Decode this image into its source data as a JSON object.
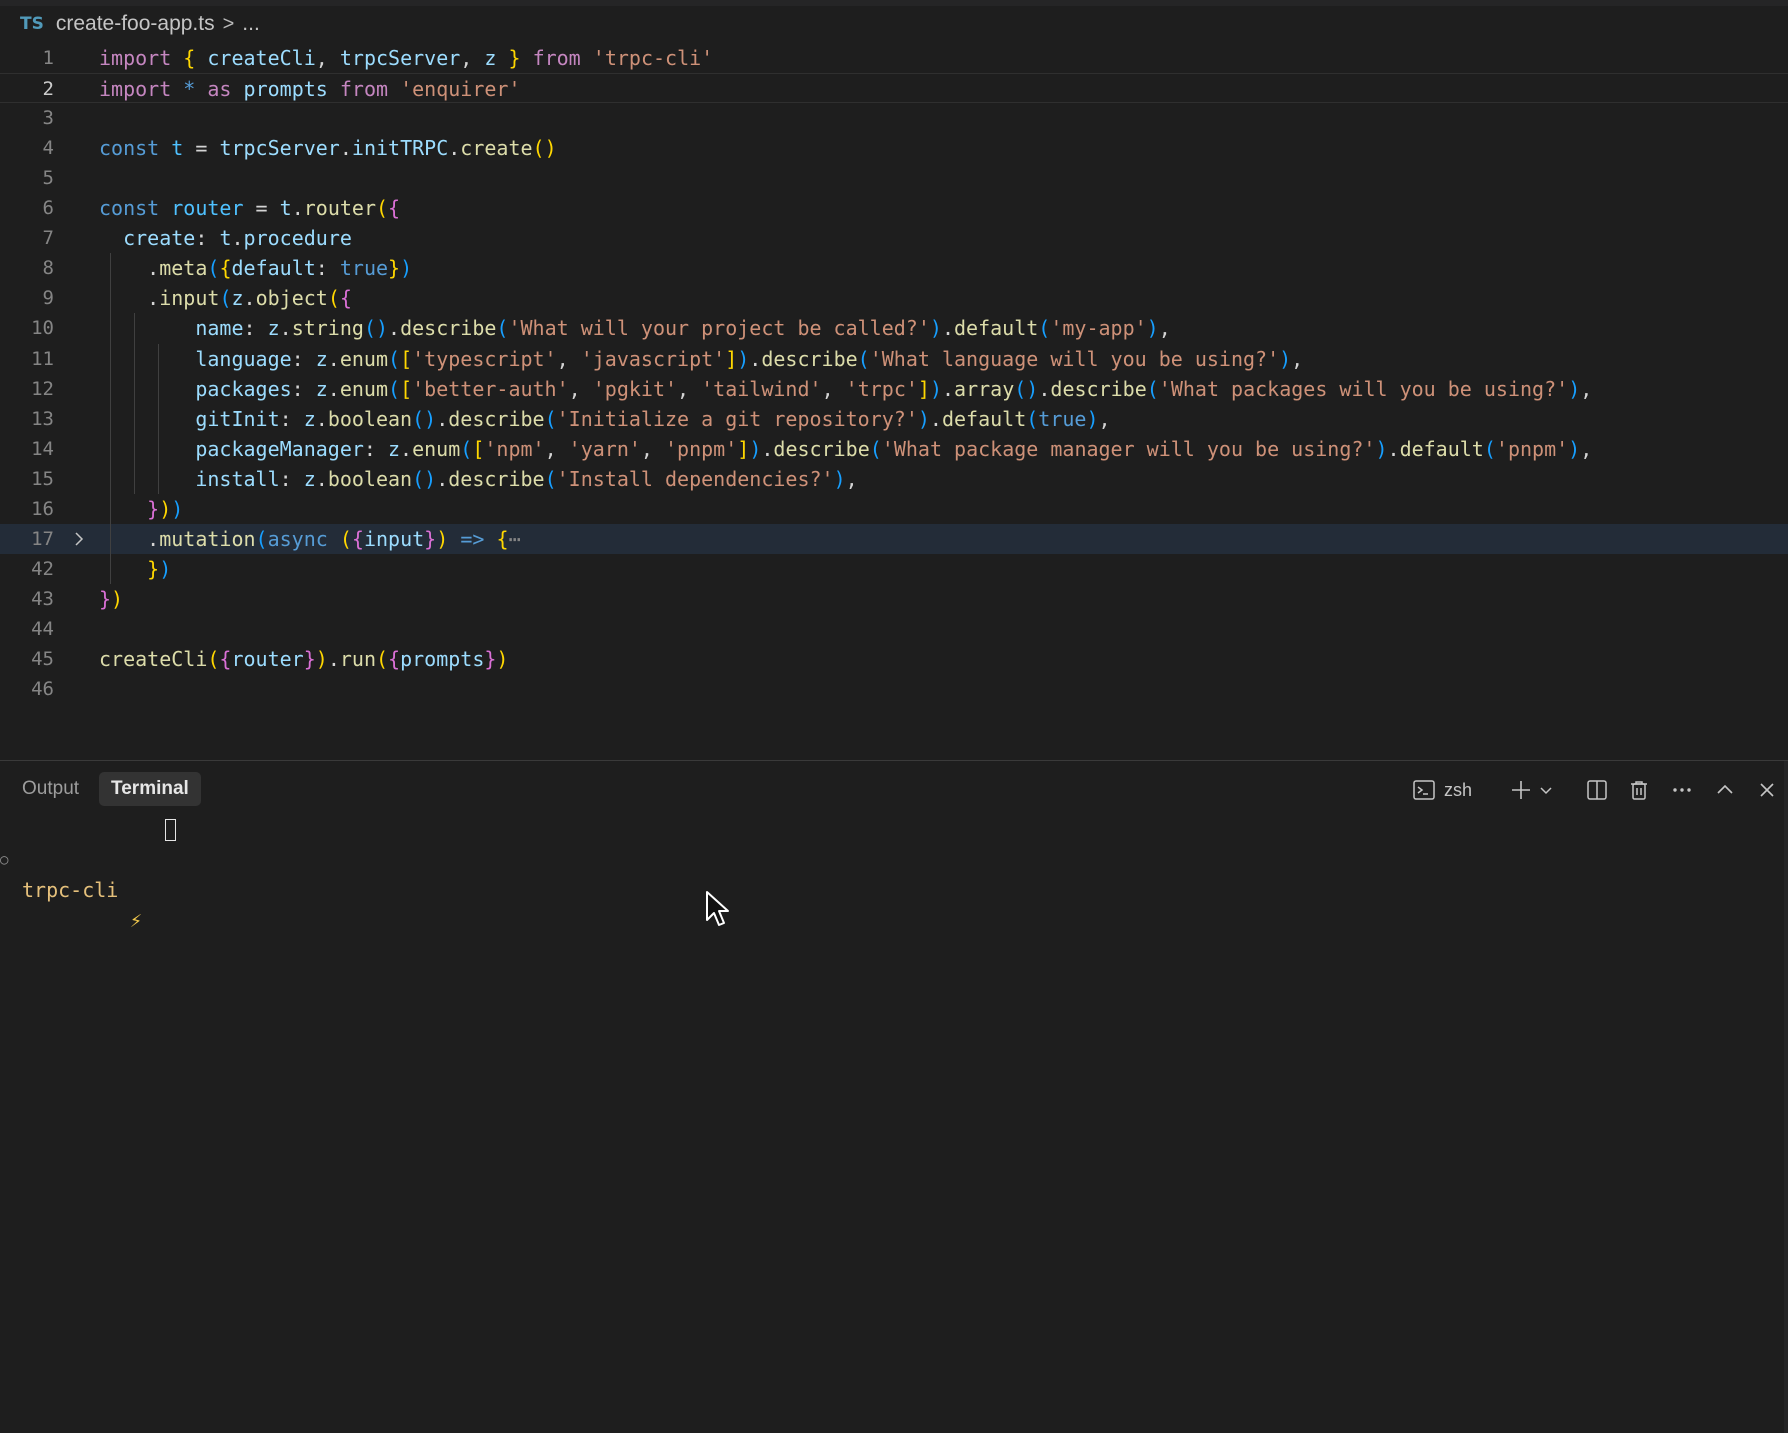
{
  "breadcrumb": {
    "lang_badge": "TS",
    "file": "create-foo-app.ts",
    "separator": ">",
    "more": "..."
  },
  "editor": {
    "active_line": "2",
    "lines": [
      {
        "num": "1",
        "tokens": [
          [
            "kw",
            "import"
          ],
          [
            "pn",
            " "
          ],
          [
            "b1",
            "{"
          ],
          [
            "pn",
            " "
          ],
          [
            "vr",
            "createCli"
          ],
          [
            "pn",
            ", "
          ],
          [
            "vr",
            "trpcServer"
          ],
          [
            "pn",
            ", "
          ],
          [
            "vr",
            "z"
          ],
          [
            "pn",
            " "
          ],
          [
            "b1",
            "}"
          ],
          [
            "pn",
            " "
          ],
          [
            "kw",
            "from"
          ],
          [
            "pn",
            " "
          ],
          [
            "st",
            "'trpc-cli'"
          ]
        ]
      },
      {
        "num": "2",
        "tokens": [
          [
            "kw",
            "import"
          ],
          [
            "pn",
            " "
          ],
          [
            "bl",
            "*"
          ],
          [
            "pn",
            " "
          ],
          [
            "kw",
            "as"
          ],
          [
            "pn",
            " "
          ],
          [
            "vr",
            "prompts"
          ],
          [
            "pn",
            " "
          ],
          [
            "kw",
            "from"
          ],
          [
            "pn",
            " "
          ],
          [
            "st",
            "'enquirer'"
          ]
        ]
      },
      {
        "num": "3",
        "tokens": []
      },
      {
        "num": "4",
        "tokens": [
          [
            "bl",
            "const"
          ],
          [
            "pn",
            " "
          ],
          [
            "cn",
            "t"
          ],
          [
            "pn",
            " = "
          ],
          [
            "vr",
            "trpcServer"
          ],
          [
            "pn",
            "."
          ],
          [
            "vr",
            "initTRPC"
          ],
          [
            "pn",
            "."
          ],
          [
            "fn",
            "create"
          ],
          [
            "b1",
            "()"
          ]
        ]
      },
      {
        "num": "5",
        "tokens": []
      },
      {
        "num": "6",
        "tokens": [
          [
            "bl",
            "const"
          ],
          [
            "pn",
            " "
          ],
          [
            "cn",
            "router"
          ],
          [
            "pn",
            " = "
          ],
          [
            "vr",
            "t"
          ],
          [
            "pn",
            "."
          ],
          [
            "fn",
            "router"
          ],
          [
            "b1",
            "("
          ],
          [
            "b2",
            "{"
          ]
        ]
      },
      {
        "num": "7",
        "tokens": [
          [
            "pn",
            "  "
          ],
          [
            "vr",
            "create"
          ],
          [
            "pn",
            ": "
          ],
          [
            "vr",
            "t"
          ],
          [
            "pn",
            "."
          ],
          [
            "vr",
            "procedure"
          ]
        ]
      },
      {
        "num": "8",
        "tokens": [
          [
            "pn",
            "    ."
          ],
          [
            "fn",
            "meta"
          ],
          [
            "b3",
            "("
          ],
          [
            "b1",
            "{"
          ],
          [
            "vr",
            "default"
          ],
          [
            "pn",
            ": "
          ],
          [
            "bl",
            "true"
          ],
          [
            "b1",
            "}"
          ],
          [
            "b3",
            ")"
          ]
        ]
      },
      {
        "num": "9",
        "tokens": [
          [
            "pn",
            "    ."
          ],
          [
            "fn",
            "input"
          ],
          [
            "b3",
            "("
          ],
          [
            "vr",
            "z"
          ],
          [
            "pn",
            "."
          ],
          [
            "fn",
            "object"
          ],
          [
            "b1",
            "("
          ],
          [
            "b2",
            "{"
          ]
        ]
      },
      {
        "num": "10",
        "tokens": [
          [
            "pn",
            "        "
          ],
          [
            "vr",
            "name"
          ],
          [
            "pn",
            ": "
          ],
          [
            "vr",
            "z"
          ],
          [
            "pn",
            "."
          ],
          [
            "fn",
            "string"
          ],
          [
            "b3",
            "()"
          ],
          [
            "pn",
            "."
          ],
          [
            "fn",
            "describe"
          ],
          [
            "b3",
            "("
          ],
          [
            "st",
            "'What will your project be called?'"
          ],
          [
            "b3",
            ")"
          ],
          [
            "pn",
            "."
          ],
          [
            "fn",
            "default"
          ],
          [
            "b3",
            "("
          ],
          [
            "st",
            "'my-app'"
          ],
          [
            "b3",
            ")"
          ],
          [
            "pn",
            ","
          ]
        ]
      },
      {
        "num": "11",
        "tokens": [
          [
            "pn",
            "        "
          ],
          [
            "vr",
            "language"
          ],
          [
            "pn",
            ": "
          ],
          [
            "vr",
            "z"
          ],
          [
            "pn",
            "."
          ],
          [
            "fn",
            "enum"
          ],
          [
            "b3",
            "("
          ],
          [
            "b1",
            "["
          ],
          [
            "st",
            "'typescript'"
          ],
          [
            "pn",
            ", "
          ],
          [
            "st",
            "'javascript'"
          ],
          [
            "b1",
            "]"
          ],
          [
            "b3",
            ")"
          ],
          [
            "pn",
            "."
          ],
          [
            "fn",
            "describe"
          ],
          [
            "b3",
            "("
          ],
          [
            "st",
            "'What language will you be using?'"
          ],
          [
            "b3",
            ")"
          ],
          [
            "pn",
            ","
          ]
        ]
      },
      {
        "num": "12",
        "tokens": [
          [
            "pn",
            "        "
          ],
          [
            "vr",
            "packages"
          ],
          [
            "pn",
            ": "
          ],
          [
            "vr",
            "z"
          ],
          [
            "pn",
            "."
          ],
          [
            "fn",
            "enum"
          ],
          [
            "b3",
            "("
          ],
          [
            "b1",
            "["
          ],
          [
            "st",
            "'better-auth'"
          ],
          [
            "pn",
            ", "
          ],
          [
            "st",
            "'pgkit'"
          ],
          [
            "pn",
            ", "
          ],
          [
            "st",
            "'tailwind'"
          ],
          [
            "pn",
            ", "
          ],
          [
            "st",
            "'trpc'"
          ],
          [
            "b1",
            "]"
          ],
          [
            "b3",
            ")"
          ],
          [
            "pn",
            "."
          ],
          [
            "fn",
            "array"
          ],
          [
            "b3",
            "()"
          ],
          [
            "pn",
            "."
          ],
          [
            "fn",
            "describe"
          ],
          [
            "b3",
            "("
          ],
          [
            "st",
            "'What packages will you be using?'"
          ],
          [
            "b3",
            ")"
          ],
          [
            "pn",
            ","
          ]
        ]
      },
      {
        "num": "13",
        "tokens": [
          [
            "pn",
            "        "
          ],
          [
            "vr",
            "gitInit"
          ],
          [
            "pn",
            ": "
          ],
          [
            "vr",
            "z"
          ],
          [
            "pn",
            "."
          ],
          [
            "fn",
            "boolean"
          ],
          [
            "b3",
            "()"
          ],
          [
            "pn",
            "."
          ],
          [
            "fn",
            "describe"
          ],
          [
            "b3",
            "("
          ],
          [
            "st",
            "'Initialize a git repository?'"
          ],
          [
            "b3",
            ")"
          ],
          [
            "pn",
            "."
          ],
          [
            "fn",
            "default"
          ],
          [
            "b3",
            "("
          ],
          [
            "bl",
            "true"
          ],
          [
            "b3",
            ")"
          ],
          [
            "pn",
            ","
          ]
        ]
      },
      {
        "num": "14",
        "tokens": [
          [
            "pn",
            "        "
          ],
          [
            "vr",
            "packageManager"
          ],
          [
            "pn",
            ": "
          ],
          [
            "vr",
            "z"
          ],
          [
            "pn",
            "."
          ],
          [
            "fn",
            "enum"
          ],
          [
            "b3",
            "("
          ],
          [
            "b1",
            "["
          ],
          [
            "st",
            "'npm'"
          ],
          [
            "pn",
            ", "
          ],
          [
            "st",
            "'yarn'"
          ],
          [
            "pn",
            ", "
          ],
          [
            "st",
            "'pnpm'"
          ],
          [
            "b1",
            "]"
          ],
          [
            "b3",
            ")"
          ],
          [
            "pn",
            "."
          ],
          [
            "fn",
            "describe"
          ],
          [
            "b3",
            "("
          ],
          [
            "st",
            "'What package manager will you be using?'"
          ],
          [
            "b3",
            ")"
          ],
          [
            "pn",
            "."
          ],
          [
            "fn",
            "default"
          ],
          [
            "b3",
            "("
          ],
          [
            "st",
            "'pnpm'"
          ],
          [
            "b3",
            ")"
          ],
          [
            "pn",
            ","
          ]
        ]
      },
      {
        "num": "15",
        "tokens": [
          [
            "pn",
            "        "
          ],
          [
            "vr",
            "install"
          ],
          [
            "pn",
            ": "
          ],
          [
            "vr",
            "z"
          ],
          [
            "pn",
            "."
          ],
          [
            "fn",
            "boolean"
          ],
          [
            "b3",
            "()"
          ],
          [
            "pn",
            "."
          ],
          [
            "fn",
            "describe"
          ],
          [
            "b3",
            "("
          ],
          [
            "st",
            "'Install dependencies?'"
          ],
          [
            "b3",
            ")"
          ],
          [
            "pn",
            ","
          ]
        ]
      },
      {
        "num": "16",
        "tokens": [
          [
            "pn",
            "    "
          ],
          [
            "b2",
            "}"
          ],
          [
            "b1",
            ")"
          ],
          [
            "b3",
            ")"
          ]
        ]
      },
      {
        "num": "17",
        "fold": true,
        "highlight": true,
        "tokens": [
          [
            "pn",
            "    ."
          ],
          [
            "fn",
            "mutation"
          ],
          [
            "b3",
            "("
          ],
          [
            "bl",
            "async"
          ],
          [
            "pn",
            " "
          ],
          [
            "b1",
            "("
          ],
          [
            "b2",
            "{"
          ],
          [
            "vr",
            "input"
          ],
          [
            "b2",
            "}"
          ],
          [
            "b1",
            ")"
          ],
          [
            "pn",
            " "
          ],
          [
            "bl",
            "=>"
          ],
          [
            "pn",
            " "
          ],
          [
            "b1",
            "{"
          ],
          [
            "ellip",
            "⋯"
          ]
        ]
      },
      {
        "num": "42",
        "tokens": [
          [
            "pn",
            "    "
          ],
          [
            "b1",
            "}"
          ],
          [
            "b3",
            ")"
          ]
        ]
      },
      {
        "num": "43",
        "tokens": [
          [
            "b2",
            "}"
          ],
          [
            "b1",
            ")"
          ]
        ]
      },
      {
        "num": "44",
        "tokens": []
      },
      {
        "num": "45",
        "tokens": [
          [
            "fn",
            "createCli"
          ],
          [
            "b1",
            "("
          ],
          [
            "b2",
            "{"
          ],
          [
            "vr",
            "router"
          ],
          [
            "b2",
            "}"
          ],
          [
            "b1",
            ")"
          ],
          [
            "pn",
            "."
          ],
          [
            "fn",
            "run"
          ],
          [
            "b1",
            "("
          ],
          [
            "b2",
            "{"
          ],
          [
            "vr",
            "prompts"
          ],
          [
            "b2",
            "}"
          ],
          [
            "b1",
            ")"
          ]
        ]
      },
      {
        "num": "46",
        "tokens": []
      }
    ]
  },
  "panel": {
    "tabs": [
      {
        "label": "Output",
        "active": false
      },
      {
        "label": "Terminal",
        "active": true
      }
    ],
    "shell_label": "zsh",
    "icons": [
      "terminal-icon",
      "plus-icon",
      "chevron-down-icon",
      "split-icon",
      "trash-icon",
      "ellipsis-icon",
      "chevron-up-icon",
      "close-icon"
    ]
  },
  "terminal": {
    "status_dot": "○",
    "prompt": "trpc-cli",
    "bolt": "⚡"
  },
  "colors": {
    "background": "#1e1e1e",
    "keyword": "#c586c0",
    "string": "#ce9178",
    "function": "#dcdcaa",
    "variable": "#9cdcfe",
    "prompt": "#e5c07b"
  }
}
